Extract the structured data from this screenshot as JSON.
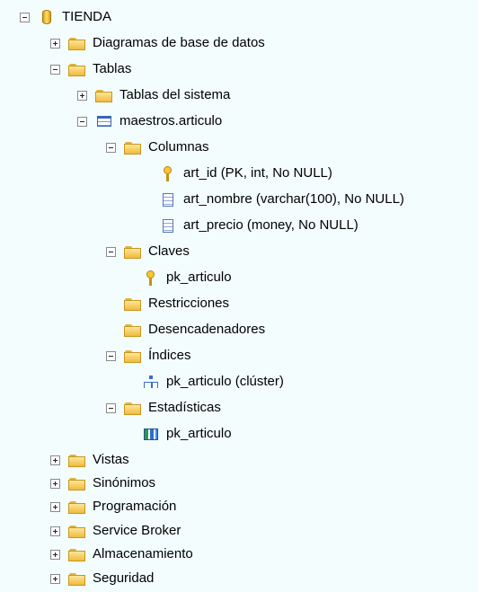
{
  "tree": {
    "root": "TIENDA",
    "diagramas": "Diagramas de base de datos",
    "tablas": "Tablas",
    "tablas_sistema": "Tablas del sistema",
    "tabla": "maestros.articulo",
    "columnas": "Columnas",
    "col_id": "art_id (PK, int, No NULL)",
    "col_nombre": "art_nombre (varchar(100), No NULL)",
    "col_precio": "art_precio (money, No NULL)",
    "claves": "Claves",
    "clave_pk": "pk_articulo",
    "restricciones": "Restricciones",
    "desencadenadores": "Desencadenadores",
    "indices": "Índices",
    "indice_pk": "pk_articulo (clúster)",
    "estadisticas": "Estadísticas",
    "estadistica_pk": "pk_articulo",
    "vistas": "Vistas",
    "sinonimos": "Sinónimos",
    "programacion": "Programación",
    "service_broker": "Service Broker",
    "almacenamiento": "Almacenamiento",
    "seguridad": "Seguridad"
  },
  "icons": {
    "database": "database-icon",
    "folder": "folder-icon",
    "table": "table-icon",
    "key": "key-icon",
    "column": "column-icon",
    "index": "index-icon",
    "statistics": "statistics-icon"
  }
}
